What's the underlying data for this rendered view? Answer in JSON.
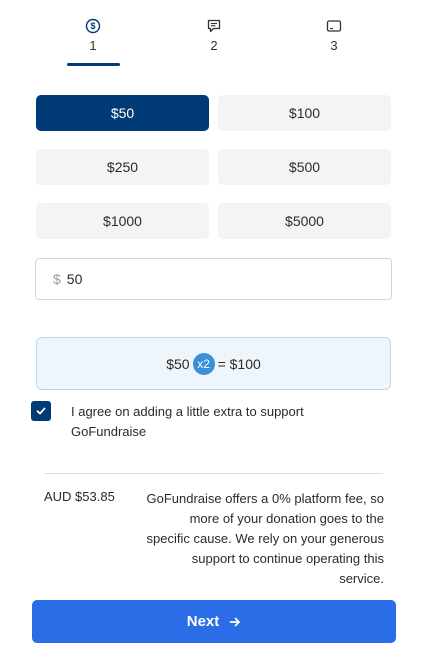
{
  "stepper": {
    "steps": [
      {
        "number": "1",
        "icon": "dollar-circle-icon",
        "active": true
      },
      {
        "number": "2",
        "icon": "message-icon",
        "active": false
      },
      {
        "number": "3",
        "icon": "card-icon",
        "active": false
      }
    ]
  },
  "amounts": {
    "options": [
      "$50",
      "$100",
      "$250",
      "$500",
      "$1000",
      "$5000"
    ],
    "selected": "$50"
  },
  "custom_amount": {
    "currency_symbol": "$",
    "value": "50"
  },
  "double_banner": {
    "amount": "$50",
    "multiplier": "x2",
    "result": "= $100"
  },
  "extra_support": {
    "checked": true,
    "label": "I agree on adding a little extra to support GoFundraise"
  },
  "summary": {
    "total": "AUD $53.85",
    "fee_note": "GoFundraise offers a 0% platform fee, so more of your donation goes to the specific cause. We rely on your generous support to continue operating this service."
  },
  "next_button": {
    "label": "Next",
    "icon": "arrow-right-icon"
  },
  "colors": {
    "primary_dark": "#003b78",
    "accent_blue": "#2b6de6",
    "multiplier_blue": "#3a8fd9"
  }
}
